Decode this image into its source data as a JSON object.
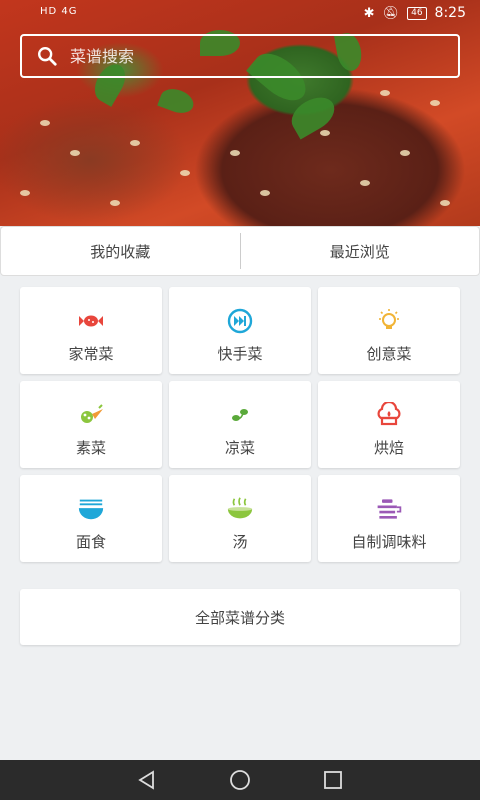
{
  "status_bar": {
    "left_indicators": "HD 4G",
    "battery": "46",
    "time": "8:25"
  },
  "search": {
    "placeholder": "菜谱搜索"
  },
  "tabs": [
    {
      "label": "我的收藏"
    },
    {
      "label": "最近浏览"
    }
  ],
  "categories": [
    {
      "label": "家常菜",
      "icon": "candy-icon",
      "color": "#e8463c"
    },
    {
      "label": "快手菜",
      "icon": "fast-forward-icon",
      "color": "#1fa7d8"
    },
    {
      "label": "创意菜",
      "icon": "lightbulb-icon",
      "color": "#f1b436"
    },
    {
      "label": "素菜",
      "icon": "vegetable-icon",
      "color": "#8cc63e"
    },
    {
      "label": "凉菜",
      "icon": "sprout-icon",
      "color": "#5aa93a"
    },
    {
      "label": "烘焙",
      "icon": "chef-hat-icon",
      "color": "#e8463c"
    },
    {
      "label": "面食",
      "icon": "noodle-bowl-icon",
      "color": "#1fa7d8"
    },
    {
      "label": "汤",
      "icon": "soup-bowl-icon",
      "color": "#8cc63e"
    },
    {
      "label": "自制调味料",
      "icon": "seasoning-pot-icon",
      "color": "#9b59b6"
    }
  ],
  "all_categories_label": "全部菜谱分类",
  "nav": {
    "back_icon": "back-triangle-icon",
    "home_icon": "home-circle-icon",
    "recent_icon": "recent-square-icon"
  }
}
